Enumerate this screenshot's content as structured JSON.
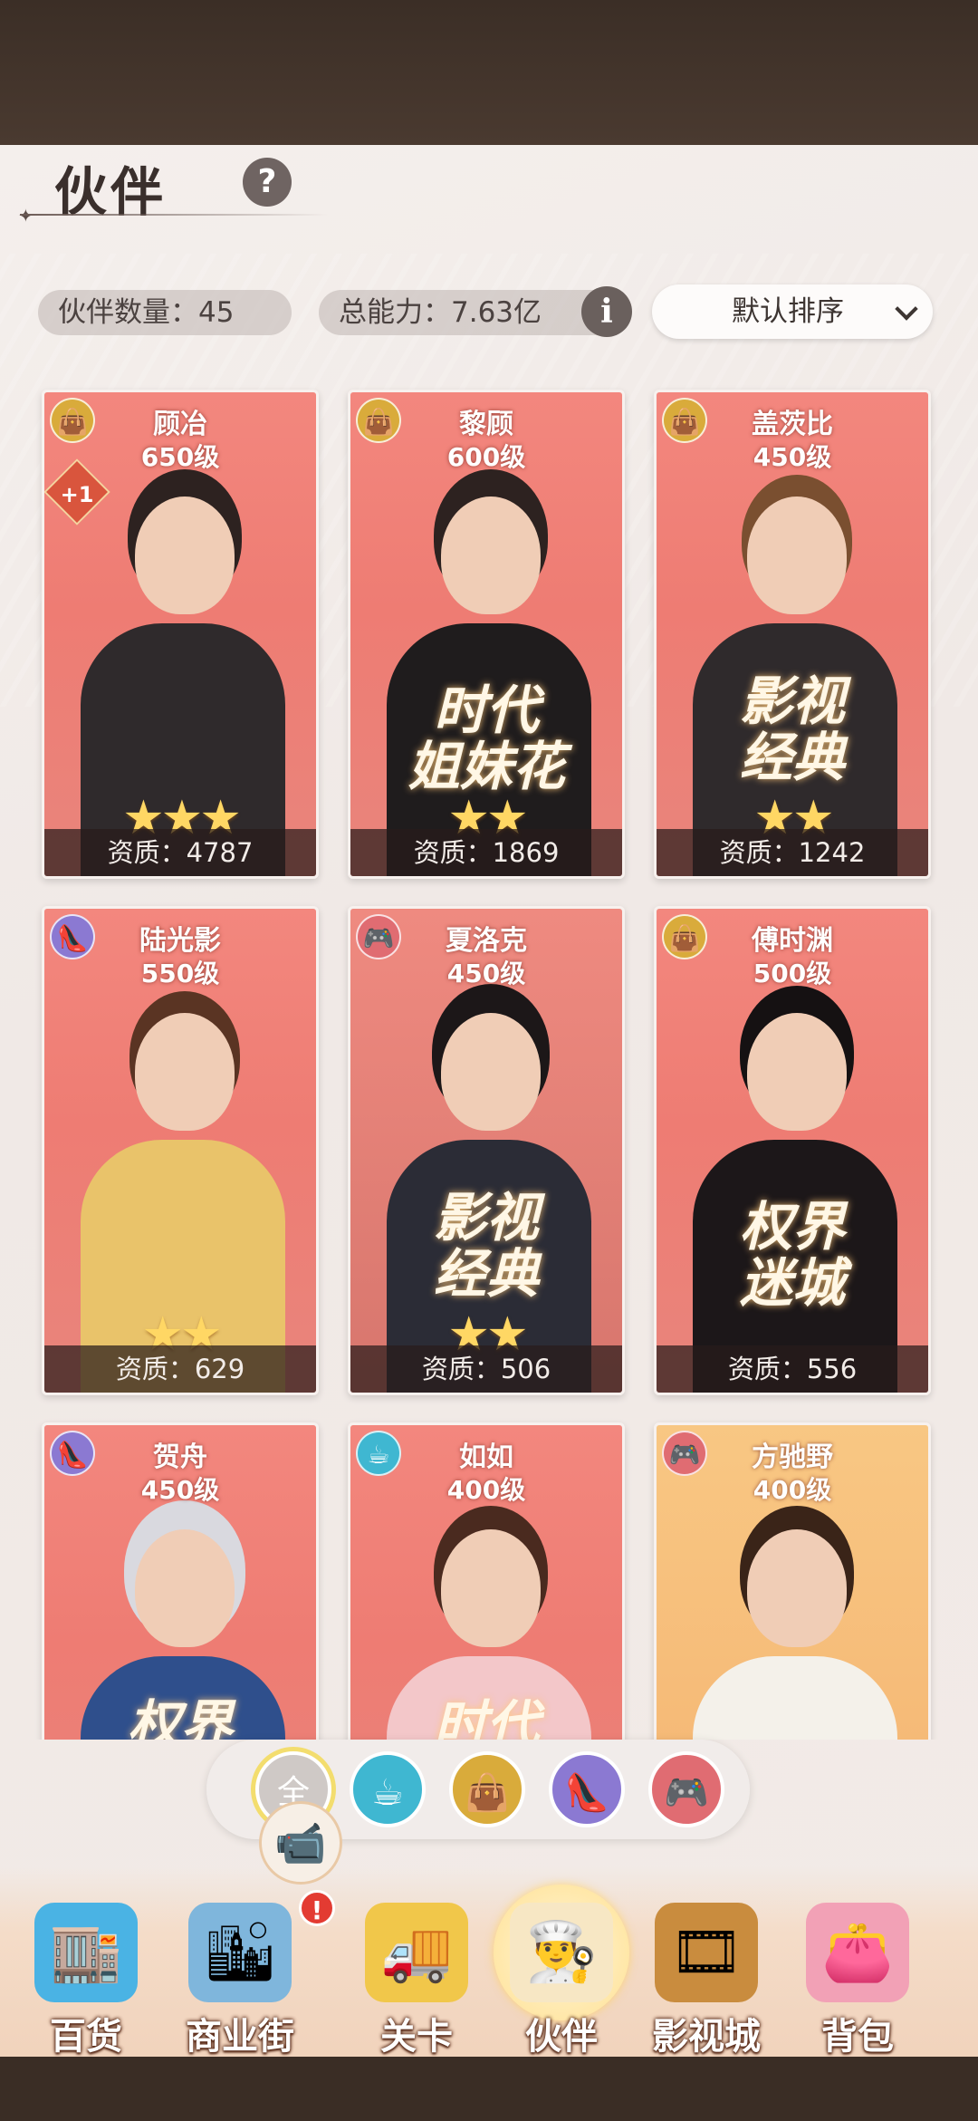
{
  "header": {
    "title": "伙伴",
    "help_glyph": "?"
  },
  "stats": {
    "partner_count": "伙伴数量：45",
    "total_power": "总能力：7.63亿",
    "info_glyph": "i",
    "sort_label": "默认排序"
  },
  "cards": [
    {
      "name": "顾冶",
      "level": "650级",
      "category_icon": "shopping-bag-icon",
      "category_glyph": "👜",
      "stars": "★★★",
      "quality": "资质：4787",
      "badge": "+1",
      "series_logo": ""
    },
    {
      "name": "黎顾",
      "level": "600级",
      "category_icon": "shopping-bag-icon",
      "category_glyph": "👜",
      "stars": "★★",
      "quality": "资质：1869",
      "badge": "",
      "series_logo": "时代\n姐妹花"
    },
    {
      "name": "盖茨比",
      "level": "450级",
      "category_icon": "shopping-bag-icon",
      "category_glyph": "👜",
      "stars": "★★",
      "quality": "资质：1242",
      "badge": "",
      "series_logo": "影视\n经典"
    },
    {
      "name": "陆光影",
      "level": "550级",
      "category_icon": "high-heel-icon",
      "category_glyph": "👠",
      "stars": "★★",
      "quality": "资质：629",
      "badge": "",
      "series_logo": ""
    },
    {
      "name": "夏洛克",
      "level": "450级",
      "category_icon": "gamepad-icon",
      "category_glyph": "🎮",
      "stars": "★★",
      "quality": "资质：506",
      "badge": "",
      "series_logo": "影视\n经典"
    },
    {
      "name": "傅时渊",
      "level": "500级",
      "category_icon": "shopping-bag-icon",
      "category_glyph": "👜",
      "stars": "",
      "quality": "资质：556",
      "badge": "",
      "series_logo": "权界\n迷城"
    },
    {
      "name": "贺舟",
      "level": "450级",
      "category_icon": "high-heel-icon",
      "category_glyph": "👠",
      "stars": "",
      "quality": "",
      "badge": "",
      "series_logo": "权界"
    },
    {
      "name": "如如",
      "level": "400级",
      "category_icon": "coffee-cup-icon",
      "category_glyph": "☕",
      "stars": "",
      "quality": "",
      "badge": "",
      "series_logo": "时代"
    },
    {
      "name": "方驰野",
      "level": "400级",
      "category_icon": "gamepad-icon",
      "category_glyph": "🎮",
      "stars": "",
      "quality": "",
      "badge": "",
      "series_logo": ""
    }
  ],
  "filters": [
    {
      "label": "全",
      "icon": "all-filter"
    },
    {
      "glyph": "☕",
      "icon": "coffee-cup-icon",
      "color": "#3fb7d1"
    },
    {
      "glyph": "👜",
      "icon": "shopping-bag-icon",
      "color": "#d9ab3b"
    },
    {
      "glyph": "👠",
      "icon": "high-heel-icon",
      "color": "#8b79d2"
    },
    {
      "glyph": "🎮",
      "icon": "gamepad-icon",
      "color": "#e06c72"
    }
  ],
  "nav": [
    {
      "label": "百货",
      "glyph": "🏬",
      "icon": "department-store-icon"
    },
    {
      "label": "商业街",
      "glyph": "🏙",
      "icon": "business-street-icon"
    },
    {
      "label": "关卡",
      "glyph": "🚚",
      "icon": "stage-truck-icon"
    },
    {
      "label": "伙伴",
      "glyph": "👨‍🍳",
      "icon": "partner-icon",
      "active": true
    },
    {
      "label": "影视城",
      "glyph": "🎞",
      "icon": "film-city-icon"
    },
    {
      "label": "背包",
      "glyph": "👛",
      "icon": "backpack-icon"
    }
  ],
  "notifications": {
    "alert_glyph": "!",
    "video_glyph": "📹"
  },
  "colors": {
    "card_pink": "#ee7c73",
    "card_gold": "#f6bb78",
    "nav_bg": "#f4dcc8"
  }
}
